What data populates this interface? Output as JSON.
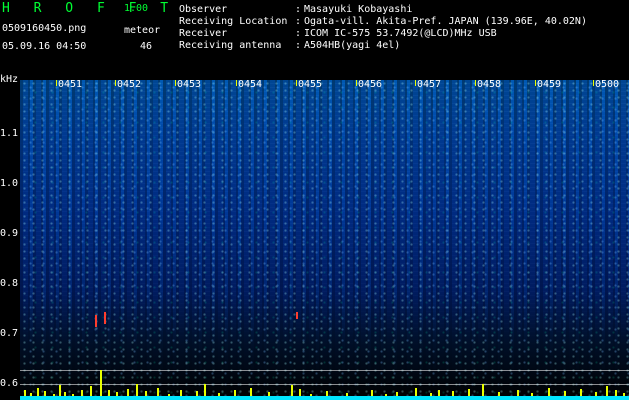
{
  "app": {
    "title": "H R O F F T",
    "version": "1.00",
    "filename": "0509160450.png",
    "meteor_label": "meteor",
    "timestamp": "05.09.16 04:50",
    "meteor_count": "46"
  },
  "metadata": {
    "observer_key": "Observer",
    "observer_value": "Masayuki Kobayashi",
    "location_key": "Receiving Location",
    "location_value": "Ogata-vill. Akita-Pref. JAPAN (139.96E, 40.02N)",
    "receiver_key": "Receiver",
    "receiver_value": "ICOM IC-575 53.7492(@LCD)MHz USB",
    "antenna_key": "Receiving antenna",
    "antenna_value": "A504HB(yagi 4el)",
    "separator": ":"
  },
  "spectrogram": {
    "y_axis_unit": "kHz",
    "y_ticks": [
      "1.1",
      "1.0",
      "0.9",
      "0.8",
      "0.7",
      "0.6"
    ],
    "time_labels": [
      "0451",
      "0452",
      "0453",
      "0454",
      "0455",
      "0456",
      "0457",
      "0458",
      "0459",
      "0500"
    ],
    "colors": {
      "accent": "#00ff33",
      "marker": "#e8ff00",
      "meteor": "#ff3d2e",
      "baseline": "#00e6ff",
      "background": "#000000"
    }
  }
}
